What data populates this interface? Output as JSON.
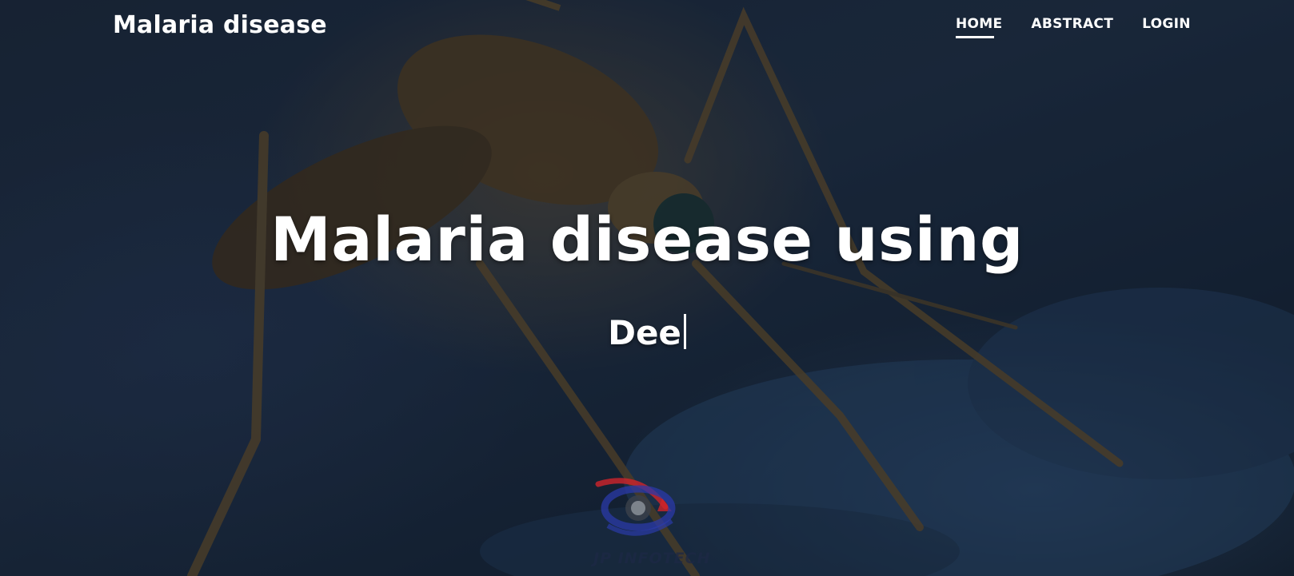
{
  "brand": {
    "title": "Malaria disease"
  },
  "nav": {
    "items": [
      {
        "label": "HOME",
        "active": true
      },
      {
        "label": "ABSTRACT",
        "active": false
      },
      {
        "label": "LOGIN",
        "active": false
      }
    ]
  },
  "hero": {
    "title": "Malaria disease using",
    "typing_text": "Dee"
  },
  "watermark": {
    "text": "JP INFOTECH"
  },
  "colors": {
    "text": "#ffffff",
    "logo_red": "#d0242b",
    "logo_blue": "#2b3aa8"
  }
}
